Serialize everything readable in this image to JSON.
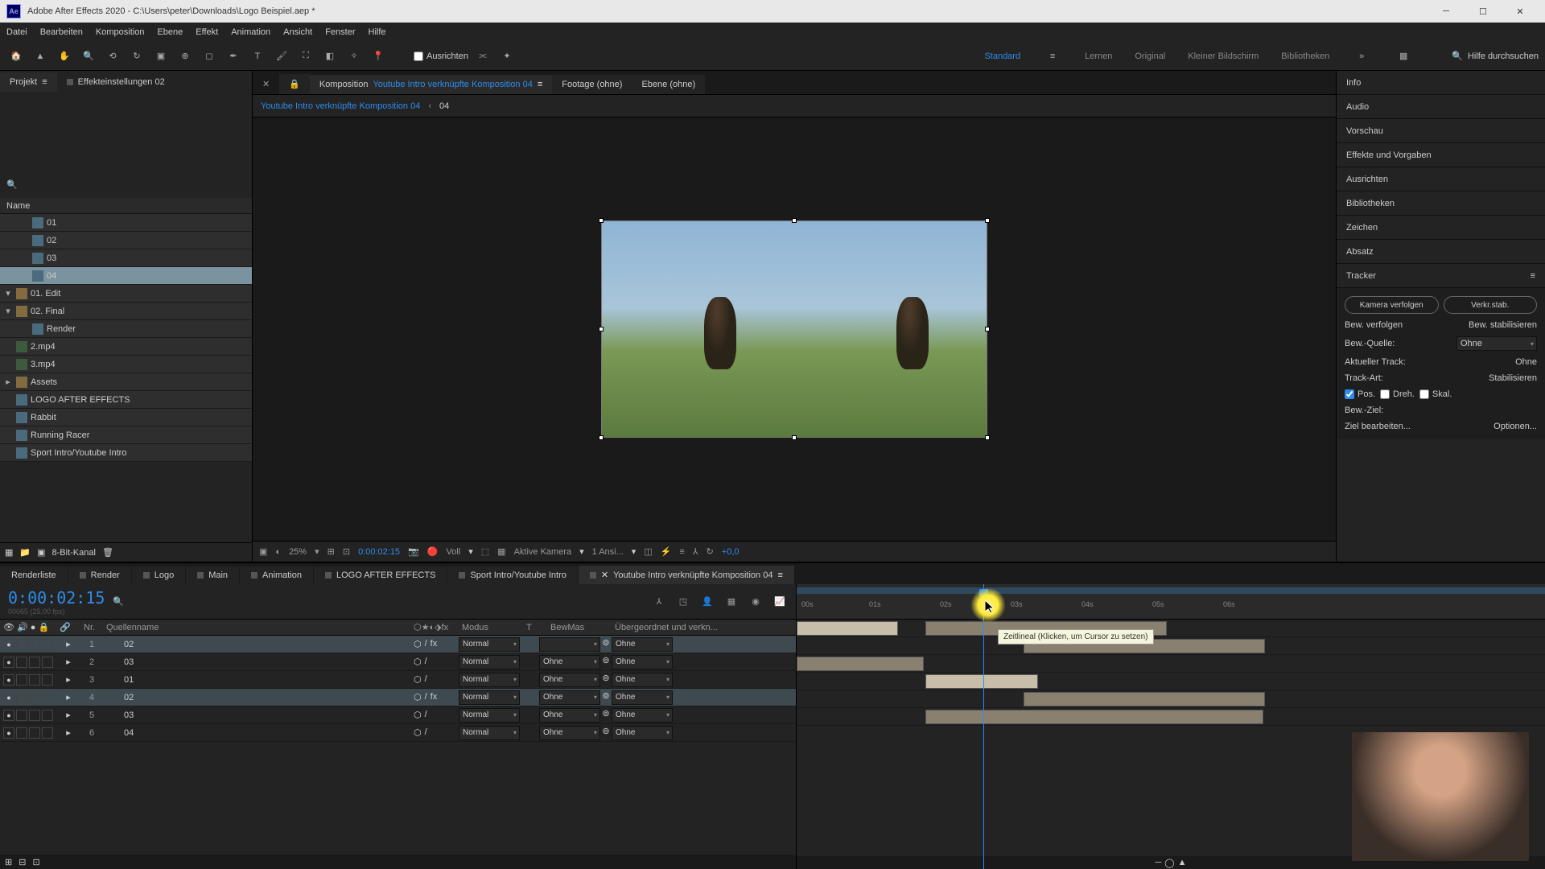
{
  "title": "Adobe After Effects 2020 - C:\\Users\\peter\\Downloads\\Logo Beispiel.aep *",
  "menu": [
    "Datei",
    "Bearbeiten",
    "Komposition",
    "Ebene",
    "Effekt",
    "Animation",
    "Ansicht",
    "Fenster",
    "Hilfe"
  ],
  "toolbar": {
    "ausrichten": "Ausrichten"
  },
  "workspaces": [
    "Standard",
    "Lernen",
    "Original",
    "Kleiner Bildschirm",
    "Bibliotheken"
  ],
  "search_help": "Hilfe durchsuchen",
  "panel_tabs": {
    "projekt": "Projekt",
    "effekt": "Effekteinstellungen 02",
    "komposition": "Komposition",
    "comp_link": "Youtube Intro verknüpfte Komposition 04",
    "footage": "Footage (ohne)",
    "ebene": "Ebene (ohne)"
  },
  "breadcrumb": {
    "a": "Youtube Intro verknüpfte Komposition 04",
    "b": "04"
  },
  "project": {
    "header": "Name",
    "items": [
      {
        "t": "comp",
        "label": "01",
        "ind": 1
      },
      {
        "t": "comp",
        "label": "02",
        "ind": 1
      },
      {
        "t": "comp",
        "label": "03",
        "ind": 1
      },
      {
        "t": "comp",
        "label": "04",
        "ind": 1,
        "sel": true
      },
      {
        "t": "folder",
        "label": "01. Edit",
        "ind": 0,
        "open": true
      },
      {
        "t": "folder",
        "label": "02. Final",
        "ind": 0,
        "open": true
      },
      {
        "t": "comp",
        "label": "Render",
        "ind": 1
      },
      {
        "t": "mov",
        "label": "2.mp4",
        "ind": 0
      },
      {
        "t": "mov",
        "label": "3.mp4",
        "ind": 0
      },
      {
        "t": "folder",
        "label": "Assets",
        "ind": 0
      },
      {
        "t": "comp",
        "label": "LOGO AFTER EFFECTS",
        "ind": 0
      },
      {
        "t": "comp",
        "label": "Rabbit",
        "ind": 0
      },
      {
        "t": "comp",
        "label": "Running Racer",
        "ind": 0
      },
      {
        "t": "comp",
        "label": "Sport Intro/Youtube Intro",
        "ind": 0
      }
    ],
    "footer_bpc": "8-Bit-Kanal"
  },
  "viewer_foot": {
    "zoom": "25%",
    "tc": "0:00:02:15",
    "res": "Voll",
    "cam": "Aktive Kamera",
    "views": "1 Ansi...",
    "exp": "+0,0"
  },
  "right_panels": [
    "Info",
    "Audio",
    "Vorschau",
    "Effekte und Vorgaben",
    "Ausrichten",
    "Bibliotheken",
    "Zeichen",
    "Absatz",
    "Tracker"
  ],
  "tracker": {
    "btn1": "Kamera verfolgen",
    "btn2": "Verkr.stab.",
    "row1a": "Bew. verfolgen",
    "row1b": "Bew. stabilisieren",
    "quelle_lbl": "Bew.-Quelle:",
    "quelle_val": "Ohne",
    "track_lbl": "Aktueller Track:",
    "track_val": "Ohne",
    "art_lbl": "Track-Art:",
    "art_val": "Stabilisieren",
    "pos": "Pos.",
    "dreh": "Dreh.",
    "skal": "Skal.",
    "ziel": "Bew.-Ziel:",
    "bearb": "Ziel bearbeiten...",
    "opt": "Optionen..."
  },
  "tl_tabs": [
    "Renderliste",
    "Render",
    "Logo",
    "Main",
    "Animation",
    "LOGO AFTER EFFECTS",
    "Sport Intro/Youtube Intro",
    "Youtube Intro verknüpfte Komposition 04"
  ],
  "timeline": {
    "tc": "0:00:02:15",
    "tc_sub": "00065 (25.00 fps)",
    "cols": {
      "nr": "Nr.",
      "name": "Quellenname",
      "modus": "Modus",
      "t": "T",
      "bew": "BewMas",
      "parent": "Übergeordnet und verkn..."
    },
    "layers": [
      {
        "n": 1,
        "name": "02",
        "mode": "Normal",
        "bew": "",
        "par": "Ohne",
        "fx": true,
        "sel": true
      },
      {
        "n": 2,
        "name": "03",
        "mode": "Normal",
        "bew": "Ohne",
        "par": "Ohne",
        "fx": false
      },
      {
        "n": 3,
        "name": "01",
        "mode": "Normal",
        "bew": "Ohne",
        "par": "Ohne",
        "fx": false
      },
      {
        "n": 4,
        "name": "02",
        "mode": "Normal",
        "bew": "Ohne",
        "par": "Ohne",
        "fx": true,
        "sel": true
      },
      {
        "n": 5,
        "name": "03",
        "mode": "Normal",
        "bew": "Ohne",
        "par": "Ohne",
        "fx": false
      },
      {
        "n": 6,
        "name": "04",
        "mode": "Normal",
        "bew": "Ohne",
        "par": "Ohne",
        "fx": false
      }
    ],
    "ruler": [
      "00s",
      "01s",
      "02s",
      "03s",
      "04s",
      "05s",
      "06s"
    ],
    "tooltip": "Zeitlineal (Klicken, um Cursor zu setzen)"
  }
}
